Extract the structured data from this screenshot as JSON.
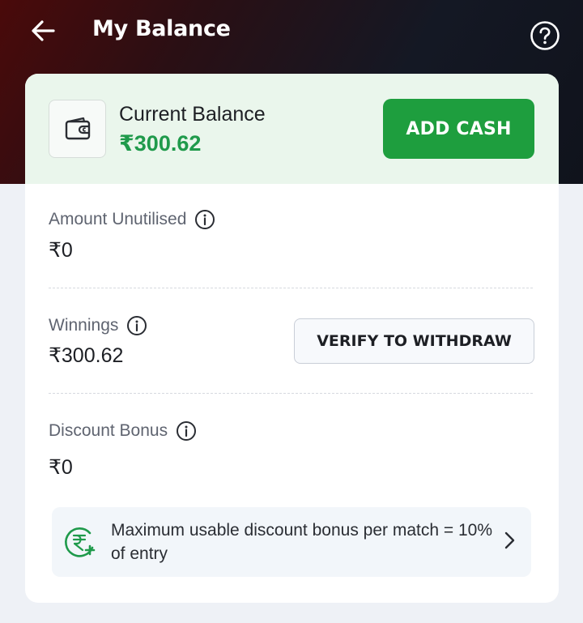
{
  "header": {
    "title": "My Balance",
    "back_icon": "arrow-left-icon",
    "help_icon": "help-circle-icon"
  },
  "current_balance": {
    "label": "Current Balance",
    "value": "₹300.62",
    "wallet_icon": "wallet-icon",
    "add_cash_label": "ADD CASH"
  },
  "amount_unutilised": {
    "label": "Amount Unutilised",
    "value": "₹0"
  },
  "winnings": {
    "label": "Winnings",
    "value": "₹300.62",
    "verify_label": "VERIFY TO WITHDRAW"
  },
  "discount_bonus": {
    "label": "Discount Bonus",
    "value": "₹0"
  },
  "promo": {
    "text": "Maximum usable discount bonus per match = 10% of entry",
    "icon": "rupee-plus-icon",
    "chevron_icon": "chevron-right-icon"
  },
  "colors": {
    "brand_green": "#1e9e3e",
    "balance_green": "#1f9a4b",
    "header_red": "#4a0a0a",
    "header_dark": "#10131c",
    "page_bg": "#eef1f6"
  }
}
